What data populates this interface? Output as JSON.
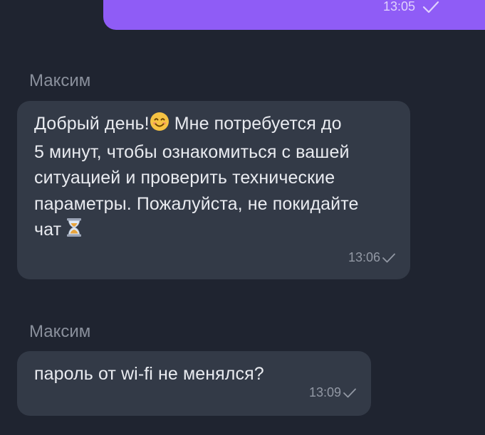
{
  "outgoing": {
    "time": "13:05"
  },
  "messages": [
    {
      "sender": "Максим",
      "text_lines": [
        "Добрый день!",
        "Мне потребуется до",
        "5 минут, чтобы ознакомиться с вашей",
        "ситуацией и проверить технические",
        "параметры. Пожалуйста, не покидайте",
        "чат"
      ],
      "time": "13:06"
    },
    {
      "sender": "Максим",
      "text": "пароль от wi-fi не менялся?",
      "time": "13:09"
    }
  ],
  "icons": {
    "smile": "smiling-face-emoji",
    "hourglass": "hourglass-emoji",
    "check": "check-icon"
  },
  "colors": {
    "background": "#1f2430",
    "outgoing_bubble": "#8f5cf6",
    "incoming_bubble": "#333a47",
    "text": "#e9ebf0",
    "muted": "#8a909c"
  }
}
